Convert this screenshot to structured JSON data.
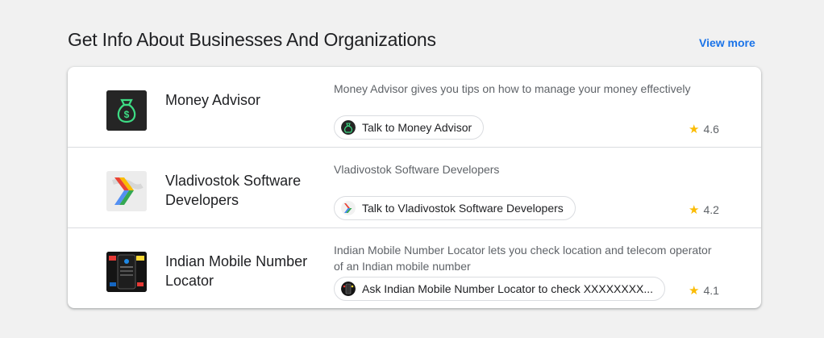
{
  "section": {
    "title": "Get Info About Businesses And Organizations",
    "view_more": "View more"
  },
  "apps": [
    {
      "name": "Money Advisor",
      "description": "Money Advisor gives you tips on how to manage your money effectively",
      "action": "Talk to Money Advisor",
      "rating": "4.6",
      "icon": "money-bag-icon"
    },
    {
      "name": "Vladivostok Software Developers",
      "description": "Vladivostok Software Developers",
      "action": "Talk to Vladivostok Software Developers",
      "rating": "4.2",
      "icon": "chevron-logo-icon"
    },
    {
      "name": "Indian Mobile Number Locator",
      "description": "Indian Mobile Number Locator lets you check location and telecom operator of an Indian mobile number",
      "action": "Ask Indian Mobile Number Locator to check XXXXXXXX...",
      "rating": "4.1",
      "icon": "phone-locator-icon"
    }
  ],
  "colors": {
    "link": "#1a73e8",
    "star": "#fbbc04",
    "money_green": "#3ddc84"
  }
}
